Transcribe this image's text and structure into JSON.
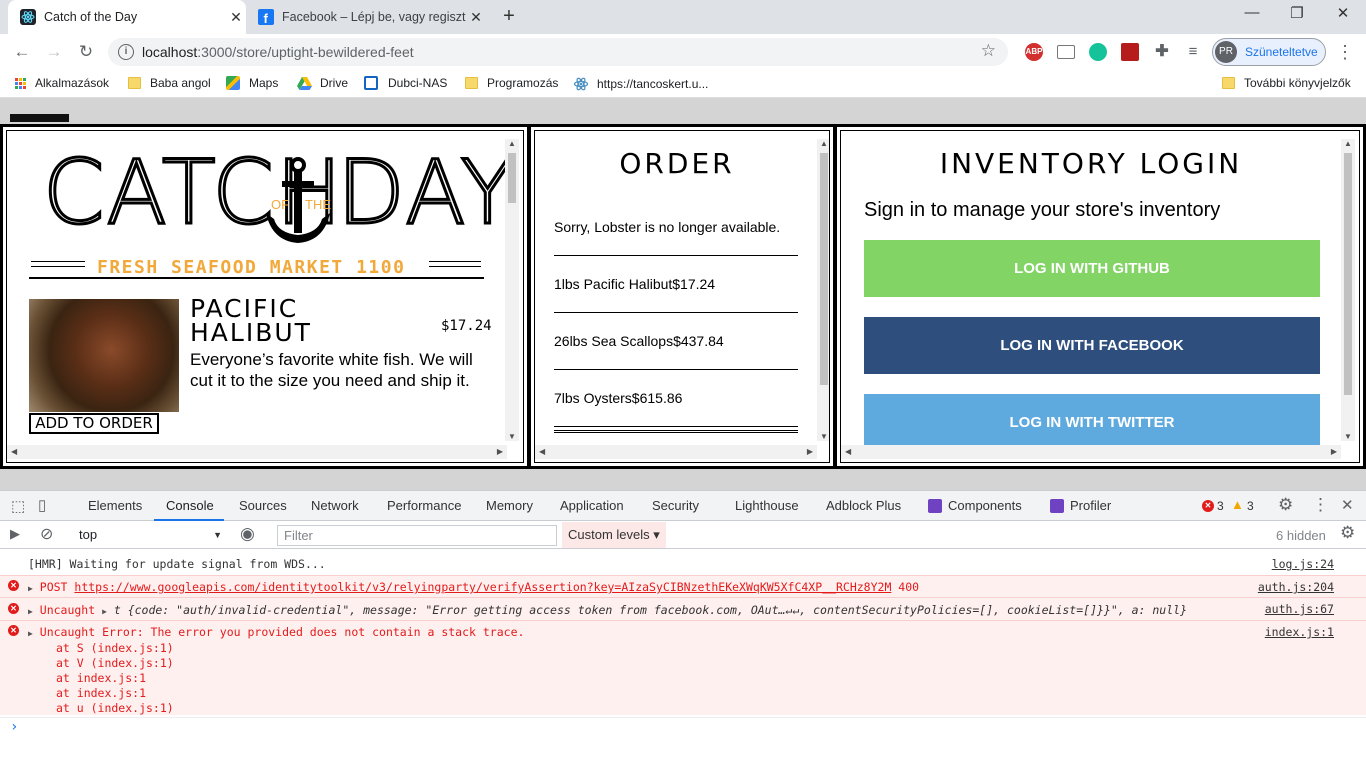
{
  "browser": {
    "tabs": [
      {
        "title": "Catch of the Day",
        "active": true
      },
      {
        "title": "Facebook – Lépj be, vagy regiszt",
        "active": false
      }
    ],
    "new_tab": "+",
    "window": {
      "minimize": "—",
      "restore": "❐",
      "close": "✕"
    },
    "url_host": "localhost",
    "url_rest": ":3000/store/uptight-bewildered-feet",
    "profile_initials": "PR",
    "profile_label": "Szüneteltetve",
    "extensions": {
      "abp": "ABP"
    }
  },
  "bookmarks": [
    {
      "label": "Alkalmazások",
      "icon": "apps-grid-icon"
    },
    {
      "label": "Baba angol",
      "icon": "folder-icon"
    },
    {
      "label": "Maps",
      "icon": "maps-icon"
    },
    {
      "label": "Drive",
      "icon": "drive-icon"
    },
    {
      "label": "Dubci-NAS",
      "icon": "nas-icon"
    },
    {
      "label": "Programozás",
      "icon": "folder-icon"
    },
    {
      "label": "https://tancoskert.u...",
      "icon": "react-icon"
    },
    {
      "label": "További könyvjelzők",
      "icon": "folder-icon"
    }
  ],
  "menu": {
    "logo": {
      "left": "CATCH",
      "of": "OF",
      "the": "THE",
      "right": "DAY"
    },
    "tagline": "FRESH SEAFOOD MARKET 1100",
    "fish": {
      "name": "PACIFIC HALIBUT",
      "price": "$17.24",
      "desc": "Everyone’s favorite white fish. We will cut it to the size you need and ship it.",
      "button": "ADD TO ORDER"
    }
  },
  "order": {
    "title": "ORDER",
    "items": [
      "Sorry, Lobster is no longer available.",
      "1lbs Pacific Halibut$17.24",
      "26lbs Sea Scallops$437.84",
      "7lbs Oysters$615.86"
    ]
  },
  "inventory": {
    "title": "INVENTORY LOGIN",
    "subtitle": "Sign in to manage your store's inventory",
    "buttons": [
      {
        "label": "LOG IN WITH GITHUB",
        "color": "#82d465"
      },
      {
        "label": "LOG IN WITH FACEBOOK",
        "color": "#3b5998"
      },
      {
        "label": "LOG IN WITH TWITTER",
        "color": "#5ea9dd"
      }
    ]
  },
  "devtools": {
    "tabs": [
      "Elements",
      "Console",
      "Sources",
      "Network",
      "Performance",
      "Memory",
      "Application",
      "Security",
      "Lighthouse",
      "Adblock Plus",
      "Components",
      "Profiler"
    ],
    "active_tab": "Console",
    "errors_count": "3",
    "warnings_count": "3",
    "context": "top",
    "filter_placeholder": "Filter",
    "levels": "Custom levels ▾",
    "hidden": "6 hidden",
    "console": [
      {
        "text": "[HMR] Waiting for update signal from WDS...",
        "source": "log.js:24",
        "type": "log"
      },
      {
        "prefix": "POST ",
        "link": "https://www.googleapis.com/identitytoolkit/v3/relyingparty/verifyAssertion?key=AIzaSyCIBNzethEKeXWqKW5XfC4XP__RCHz8Y2M",
        "suffix": " 400",
        "source": "auth.js:204",
        "type": "error"
      },
      {
        "prefix": "Uncaught ",
        "text": "t {code: \"auth/invalid-credential\", message: \"Error getting access token from facebook.com, OAut…↵↵, contentSecurityPolicies=[], cookieList=[]}}\", a: null}",
        "source": "auth.js:67",
        "type": "error"
      },
      {
        "text": "Uncaught Error: The error you provided does not contain a stack trace.",
        "source": "index.js:1",
        "type": "error",
        "stack": [
          "at S (index.js:1)",
          "at V (index.js:1)",
          "at index.js:1",
          "at index.js:1",
          "at u (index.js:1)"
        ]
      }
    ],
    "prompt": "›"
  }
}
